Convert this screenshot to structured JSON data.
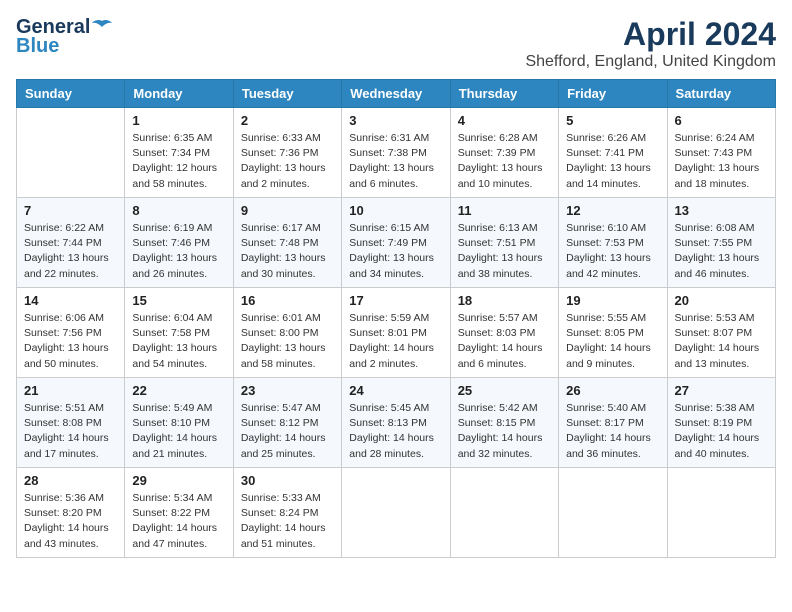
{
  "header": {
    "logo_line1": "General",
    "logo_line2": "Blue",
    "month_title": "April 2024",
    "location": "Shefford, England, United Kingdom"
  },
  "weekdays": [
    "Sunday",
    "Monday",
    "Tuesday",
    "Wednesday",
    "Thursday",
    "Friday",
    "Saturday"
  ],
  "weeks": [
    [
      {
        "day": "",
        "info": ""
      },
      {
        "day": "1",
        "info": "Sunrise: 6:35 AM\nSunset: 7:34 PM\nDaylight: 12 hours\nand 58 minutes."
      },
      {
        "day": "2",
        "info": "Sunrise: 6:33 AM\nSunset: 7:36 PM\nDaylight: 13 hours\nand 2 minutes."
      },
      {
        "day": "3",
        "info": "Sunrise: 6:31 AM\nSunset: 7:38 PM\nDaylight: 13 hours\nand 6 minutes."
      },
      {
        "day": "4",
        "info": "Sunrise: 6:28 AM\nSunset: 7:39 PM\nDaylight: 13 hours\nand 10 minutes."
      },
      {
        "day": "5",
        "info": "Sunrise: 6:26 AM\nSunset: 7:41 PM\nDaylight: 13 hours\nand 14 minutes."
      },
      {
        "day": "6",
        "info": "Sunrise: 6:24 AM\nSunset: 7:43 PM\nDaylight: 13 hours\nand 18 minutes."
      }
    ],
    [
      {
        "day": "7",
        "info": "Sunrise: 6:22 AM\nSunset: 7:44 PM\nDaylight: 13 hours\nand 22 minutes."
      },
      {
        "day": "8",
        "info": "Sunrise: 6:19 AM\nSunset: 7:46 PM\nDaylight: 13 hours\nand 26 minutes."
      },
      {
        "day": "9",
        "info": "Sunrise: 6:17 AM\nSunset: 7:48 PM\nDaylight: 13 hours\nand 30 minutes."
      },
      {
        "day": "10",
        "info": "Sunrise: 6:15 AM\nSunset: 7:49 PM\nDaylight: 13 hours\nand 34 minutes."
      },
      {
        "day": "11",
        "info": "Sunrise: 6:13 AM\nSunset: 7:51 PM\nDaylight: 13 hours\nand 38 minutes."
      },
      {
        "day": "12",
        "info": "Sunrise: 6:10 AM\nSunset: 7:53 PM\nDaylight: 13 hours\nand 42 minutes."
      },
      {
        "day": "13",
        "info": "Sunrise: 6:08 AM\nSunset: 7:55 PM\nDaylight: 13 hours\nand 46 minutes."
      }
    ],
    [
      {
        "day": "14",
        "info": "Sunrise: 6:06 AM\nSunset: 7:56 PM\nDaylight: 13 hours\nand 50 minutes."
      },
      {
        "day": "15",
        "info": "Sunrise: 6:04 AM\nSunset: 7:58 PM\nDaylight: 13 hours\nand 54 minutes."
      },
      {
        "day": "16",
        "info": "Sunrise: 6:01 AM\nSunset: 8:00 PM\nDaylight: 13 hours\nand 58 minutes."
      },
      {
        "day": "17",
        "info": "Sunrise: 5:59 AM\nSunset: 8:01 PM\nDaylight: 14 hours\nand 2 minutes."
      },
      {
        "day": "18",
        "info": "Sunrise: 5:57 AM\nSunset: 8:03 PM\nDaylight: 14 hours\nand 6 minutes."
      },
      {
        "day": "19",
        "info": "Sunrise: 5:55 AM\nSunset: 8:05 PM\nDaylight: 14 hours\nand 9 minutes."
      },
      {
        "day": "20",
        "info": "Sunrise: 5:53 AM\nSunset: 8:07 PM\nDaylight: 14 hours\nand 13 minutes."
      }
    ],
    [
      {
        "day": "21",
        "info": "Sunrise: 5:51 AM\nSunset: 8:08 PM\nDaylight: 14 hours\nand 17 minutes."
      },
      {
        "day": "22",
        "info": "Sunrise: 5:49 AM\nSunset: 8:10 PM\nDaylight: 14 hours\nand 21 minutes."
      },
      {
        "day": "23",
        "info": "Sunrise: 5:47 AM\nSunset: 8:12 PM\nDaylight: 14 hours\nand 25 minutes."
      },
      {
        "day": "24",
        "info": "Sunrise: 5:45 AM\nSunset: 8:13 PM\nDaylight: 14 hours\nand 28 minutes."
      },
      {
        "day": "25",
        "info": "Sunrise: 5:42 AM\nSunset: 8:15 PM\nDaylight: 14 hours\nand 32 minutes."
      },
      {
        "day": "26",
        "info": "Sunrise: 5:40 AM\nSunset: 8:17 PM\nDaylight: 14 hours\nand 36 minutes."
      },
      {
        "day": "27",
        "info": "Sunrise: 5:38 AM\nSunset: 8:19 PM\nDaylight: 14 hours\nand 40 minutes."
      }
    ],
    [
      {
        "day": "28",
        "info": "Sunrise: 5:36 AM\nSunset: 8:20 PM\nDaylight: 14 hours\nand 43 minutes."
      },
      {
        "day": "29",
        "info": "Sunrise: 5:34 AM\nSunset: 8:22 PM\nDaylight: 14 hours\nand 47 minutes."
      },
      {
        "day": "30",
        "info": "Sunrise: 5:33 AM\nSunset: 8:24 PM\nDaylight: 14 hours\nand 51 minutes."
      },
      {
        "day": "",
        "info": ""
      },
      {
        "day": "",
        "info": ""
      },
      {
        "day": "",
        "info": ""
      },
      {
        "day": "",
        "info": ""
      }
    ]
  ]
}
